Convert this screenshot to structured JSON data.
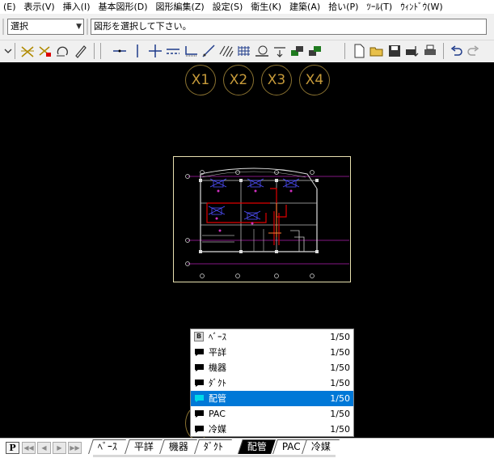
{
  "menubar": [
    "(E)",
    "表示(V)",
    "挿入(I)",
    "基本図形(D)",
    "図形編集(Z)",
    "設定(S)",
    "衛生(K)",
    "建築(A)",
    "拾い(P)",
    "ﾂｰﾙ(T)",
    "ｳｨﾝﾄﾞｳ(W)"
  ],
  "command": {
    "mode": "選択",
    "prompt": "図形を選択して下さい。"
  },
  "toolbar_icons": [
    "snap-cross-icon",
    "snap-cross-red-icon",
    "rotate-icon",
    "pen-icon",
    "horizontal-line-icon",
    "vertical-line-icon",
    "cross-line-icon",
    "dashed-line-icon",
    "step-line-icon",
    "diagonal-line-icon",
    "hatch-icon",
    "grid-hatch-icon",
    "measure-icon",
    "arrow-line-icon",
    "layer-move-icon",
    "layer-copy-icon",
    "new-file-icon",
    "open-folder-icon",
    "save-icon",
    "print-setup-icon",
    "print-icon",
    "undo-icon",
    "redo-icon"
  ],
  "grid_labels": [
    "X1",
    "X2",
    "X3",
    "X4"
  ],
  "layers": [
    {
      "name": "ﾍﾞｰｽ",
      "scale": "1/50",
      "icon": "base-layer-icon",
      "icon_letter": "B",
      "selected": false
    },
    {
      "name": "平詳",
      "scale": "1/50",
      "icon": "layer-icon",
      "selected": false
    },
    {
      "name": "機器",
      "scale": "1/50",
      "icon": "layer-icon",
      "selected": false
    },
    {
      "name": "ﾀﾞｸﾄ",
      "scale": "1/50",
      "icon": "layer-icon",
      "selected": false
    },
    {
      "name": "配管",
      "scale": "1/50",
      "icon": "layer-icon",
      "selected": true
    },
    {
      "name": "PAC",
      "scale": "1/50",
      "icon": "layer-icon",
      "selected": false
    },
    {
      "name": "冷媒",
      "scale": "1/50",
      "icon": "layer-icon",
      "selected": false
    }
  ],
  "tabstrip": {
    "page_button": "P",
    "tabs": [
      "ﾍﾞｰｽ",
      "平詳",
      "機器",
      "ﾀﾞｸﾄ",
      "配管",
      "PAC",
      "冷媒"
    ],
    "active_tab": "配管"
  },
  "colors": {
    "canvas": "#000000",
    "grid_label": "#c79b3a",
    "selection": "#0078d7",
    "active_layer_icon": "#00d8e8"
  }
}
